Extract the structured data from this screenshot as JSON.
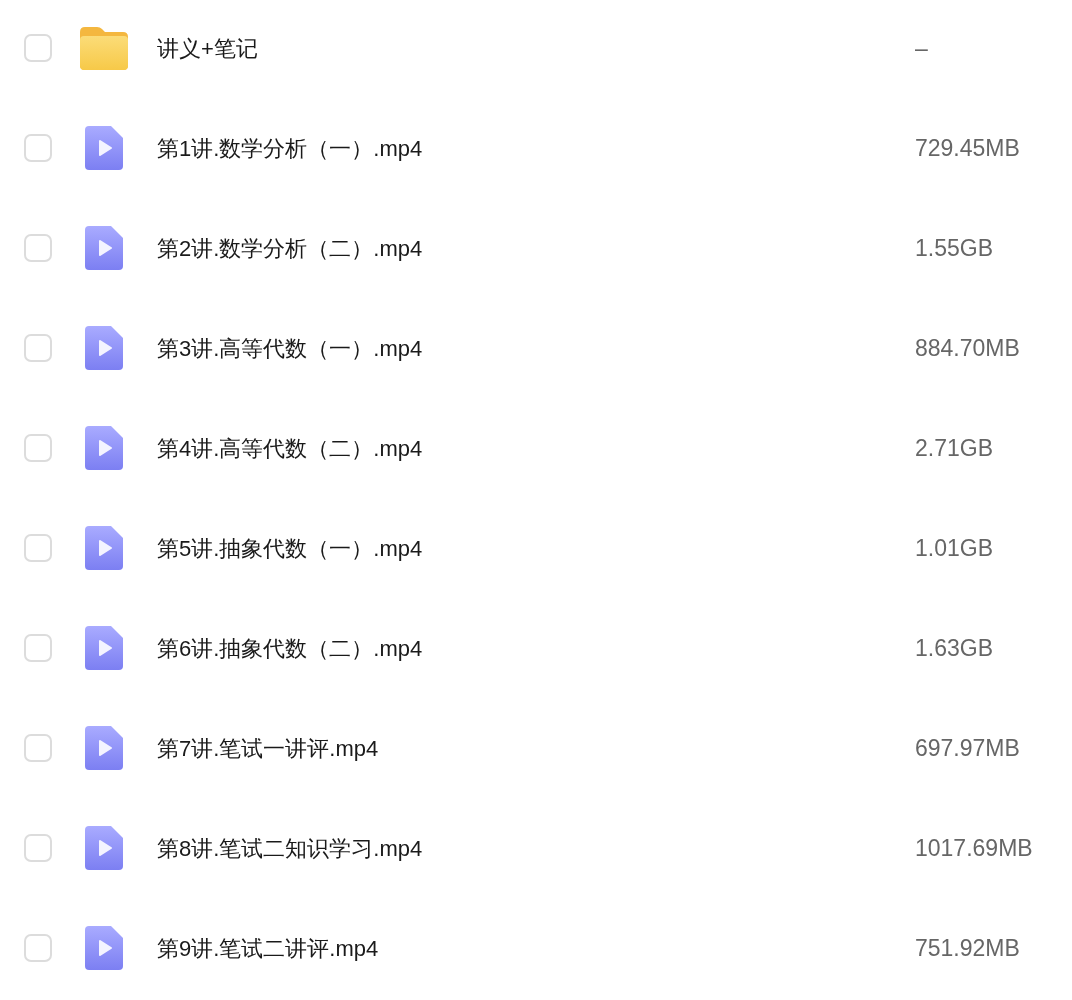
{
  "files": [
    {
      "kind": "folder",
      "name": "讲义+笔记",
      "size": "–",
      "checked": false
    },
    {
      "kind": "video",
      "name": "第1讲.数学分析（一）.mp4",
      "size": "729.45MB",
      "checked": false
    },
    {
      "kind": "video",
      "name": "第2讲.数学分析（二）.mp4",
      "size": "1.55GB",
      "checked": false
    },
    {
      "kind": "video",
      "name": "第3讲.高等代数（一）.mp4",
      "size": "884.70MB",
      "checked": false
    },
    {
      "kind": "video",
      "name": "第4讲.高等代数（二）.mp4",
      "size": "2.71GB",
      "checked": false
    },
    {
      "kind": "video",
      "name": "第5讲.抽象代数（一）.mp4",
      "size": "1.01GB",
      "checked": false
    },
    {
      "kind": "video",
      "name": "第6讲.抽象代数（二）.mp4",
      "size": "1.63GB",
      "checked": false
    },
    {
      "kind": "video",
      "name": "第7讲.笔试一讲评.mp4",
      "size": "697.97MB",
      "checked": false
    },
    {
      "kind": "video",
      "name": "第8讲.笔试二知识学习.mp4",
      "size": "1017.69MB",
      "checked": false
    },
    {
      "kind": "video",
      "name": "第9讲.笔试二讲评.mp4",
      "size": "751.92MB",
      "checked": false
    }
  ]
}
